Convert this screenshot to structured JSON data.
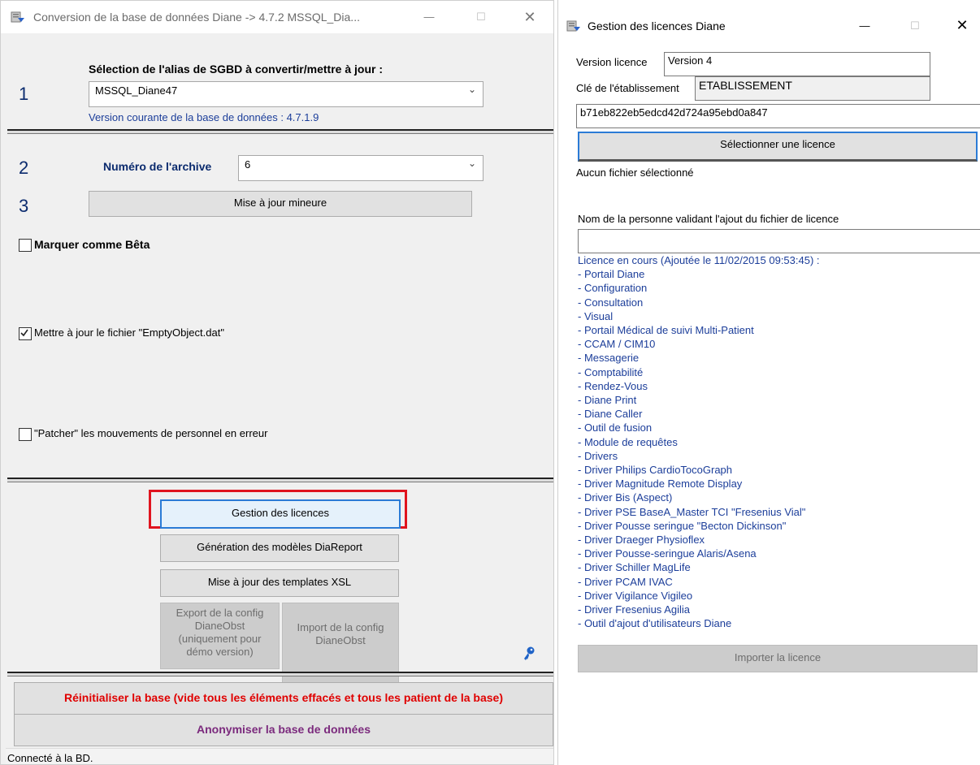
{
  "win1": {
    "title": "Conversion de la base de données Diane -> 4.7.2 MSSQL_Dia...",
    "section1": {
      "number": "1",
      "heading": "Sélection de l'alias de SGBD à convertir/mettre à jour :",
      "alias_value": "MSSQL_Diane47",
      "version_text": "Version courante de la base de données : 4.7.1.9"
    },
    "section2": {
      "number": "2",
      "label": "Numéro de l'archive",
      "value": "6"
    },
    "section3": {
      "number": "3",
      "button": "Mise à jour mineure"
    },
    "options": {
      "beta": {
        "label": "Marquer comme Bêta",
        "checked": false
      },
      "emptyobject": {
        "label": "Mettre à jour le fichier \"EmptyObject.dat\"",
        "checked": true
      },
      "patcher": {
        "label": "\"Patcher\" les mouvements de personnel en erreur",
        "checked": false
      }
    },
    "buttons": {
      "licences": "Gestion des licences",
      "diareport": "Génération des modèles DiaReport",
      "xsl": "Mise à jour des templates XSL",
      "export": [
        "Export de la config",
        "DianeObst",
        "(uniquement pour",
        "démo version)"
      ],
      "import": [
        "Import de la config",
        "DianeObst"
      ],
      "reinit": "Réinitialiser la base (vide tous les éléments effacés et tous les patient de la base)",
      "anonymise": "Anonymiser la base de données"
    },
    "status": "Connecté à la BD.",
    "colors": {
      "reinit_text": "#e00000",
      "anonymise_text": "#7b2a7d",
      "highlight_border": "#e0141e",
      "focus_border": "#2b7bd6"
    }
  },
  "win2": {
    "title": "Gestion des licences Diane",
    "version_label": "Version licence",
    "version_value": "Version 4",
    "cle_label": "Clé de l'établissement",
    "cle_value": "ETABLISSEMENT",
    "hash_value": "b71eb822eb5edcd42d724a95ebd0a847",
    "select_button": "Sélectionner une licence",
    "no_file": "Aucun fichier sélectionné",
    "person_label": "Nom de la personne validant l'ajout du fichier de licence",
    "person_value": "",
    "licence_header": "Licence en cours (Ajoutée le 11/02/2015 09:53:45) :",
    "licence_items": [
      " - Portail Diane",
      " - Configuration",
      " - Consultation",
      " - Visual",
      " - Portail Médical de suivi Multi-Patient",
      " - CCAM / CIM10",
      " - Messagerie",
      " - Comptabilité",
      " - Rendez-Vous",
      " - Diane Print",
      " - Diane Caller",
      " - Outil de fusion",
      " - Module de requêtes",
      " - Drivers",
      " - Driver Philips CardioTocoGraph",
      " - Driver Magnitude Remote Display",
      " - Driver Bis (Aspect)",
      " - Driver PSE  BaseA_Master TCI \"Fresenius Vial\"",
      " - Driver Pousse seringue \"Becton Dickinson\"",
      " - Driver Draeger Physioflex",
      " - Driver Pousse-seringue Alaris/Asena",
      " - Driver Schiller MagLife",
      " - Driver PCAM IVAC",
      " - Driver Vigilance Vigileo",
      " - Driver Fresenius Agilia",
      " - Outil d'ajout d'utilisateurs Diane"
    ],
    "import_button": "Importer la licence"
  }
}
